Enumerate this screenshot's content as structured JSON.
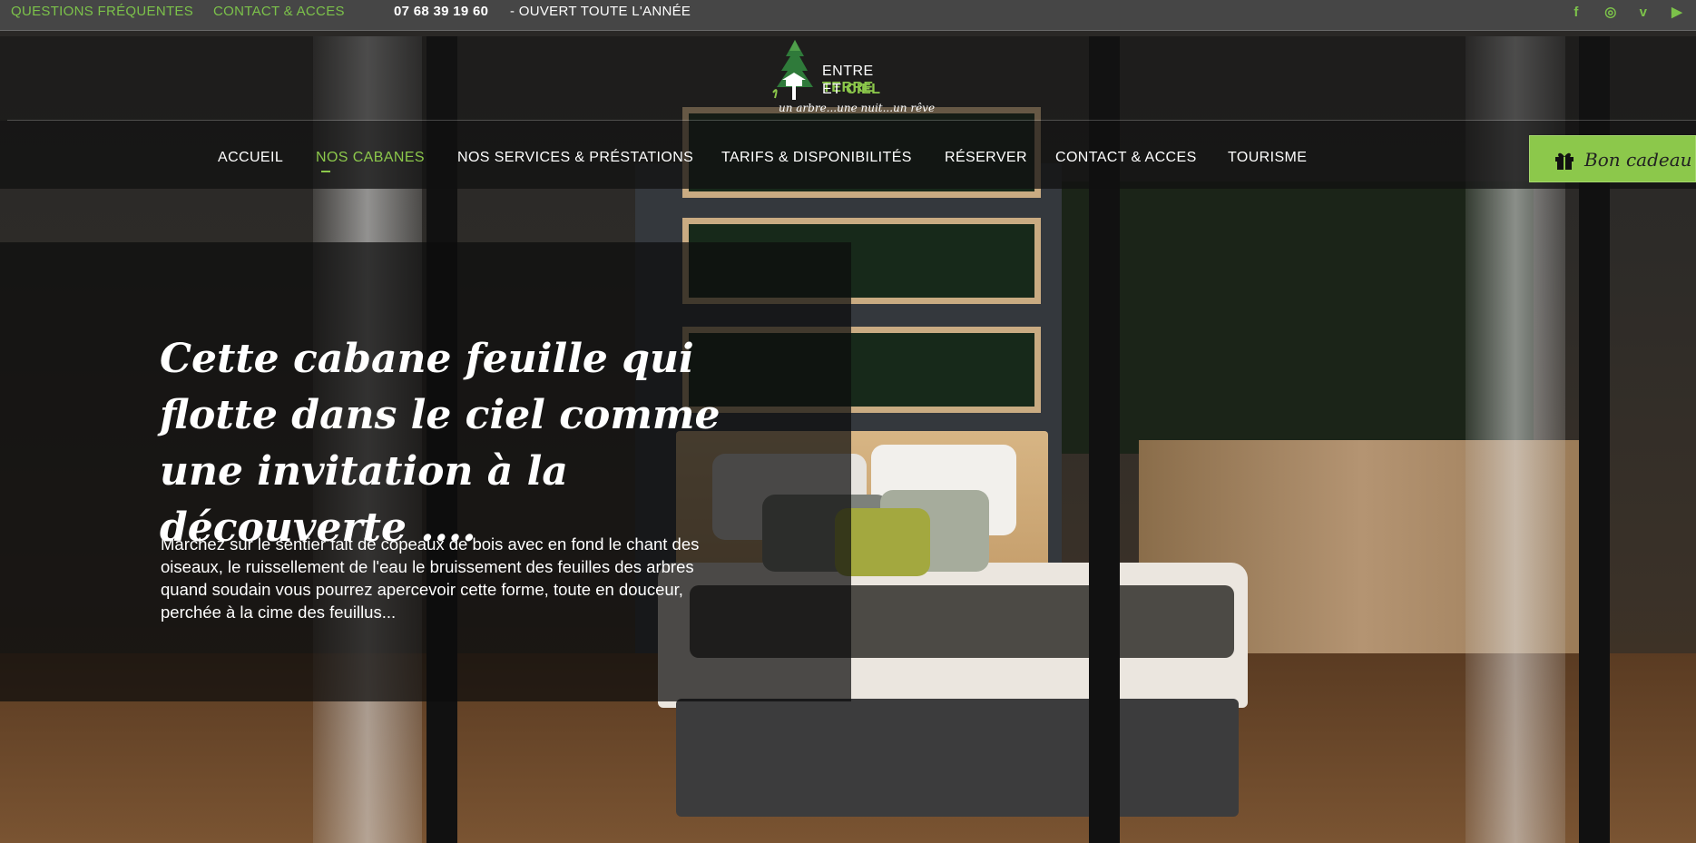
{
  "topbar": {
    "faq_link": "QUESTIONS FRÉQUENTES",
    "contact_link": "CONTACT & ACCES",
    "phone": "07 68 39 19 60",
    "open_text": "- OUVERT TOUTE L'ANNÉE",
    "social": [
      {
        "icon": "facebook-icon",
        "glyph": "f"
      },
      {
        "icon": "instagram-icon",
        "glyph": "◎"
      },
      {
        "icon": "vimeo-icon",
        "glyph": "v"
      },
      {
        "icon": "youtube-icon",
        "glyph": "▶"
      }
    ]
  },
  "logo": {
    "line1_a": "ENTRE ",
    "line1_b": "TERRE",
    "line2_a": "ET ",
    "line2_b": "CIEL",
    "tagline": "un arbre...une nuit...un rêve"
  },
  "nav": {
    "items": [
      {
        "label": "ACCUEIL",
        "active": false
      },
      {
        "label": "NOS CABANES",
        "active": true
      },
      {
        "label": "NOS SERVICES & PRÉSTATIONS",
        "active": false
      },
      {
        "label": "TARIFS & DISPONIBILITÉS",
        "active": false
      },
      {
        "label": "RÉSERVER",
        "active": false
      },
      {
        "label": "CONTACT & ACCES",
        "active": false
      },
      {
        "label": "TOURISME",
        "active": false
      }
    ],
    "gift_button": "Bon cadeau"
  },
  "hero": {
    "title": "Cette cabane feuille qui flotte dans le ciel comme une invitation à la découverte ....",
    "text": "Marchez sur le sentier fait de copeaux de bois avec en fond le chant des oiseaux, le ruissellement de l'eau le bruissement des feuilles des arbres quand soudain vous pourrez apercevoir cette forme, toute en douceur, perchée à la cime des feuillus..."
  },
  "colors": {
    "accent_green": "#8cc84b",
    "topbar_bg": "#464646",
    "panel_bg": "rgba(12,12,12,0.72)"
  }
}
